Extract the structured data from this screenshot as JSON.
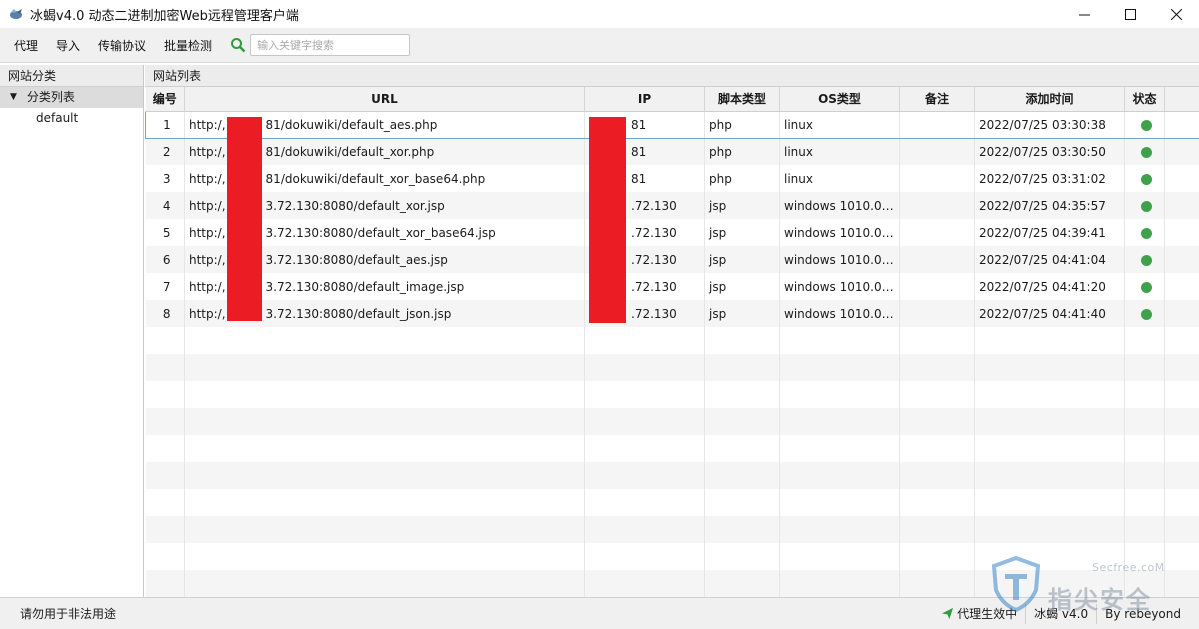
{
  "window": {
    "title": "冰蝎v4.0 动态二进制加密Web远程管理客户端"
  },
  "menu": {
    "items": [
      "代理",
      "导入",
      "传输协议",
      "批量检测"
    ],
    "search_placeholder": "输入关键字搜索"
  },
  "left_panel": {
    "header": "网站分类",
    "tree_root": "分类列表",
    "tree_children": [
      "default"
    ]
  },
  "right_panel": {
    "header": "网站列表",
    "columns": [
      "编号",
      "URL",
      "IP",
      "脚本类型",
      "OS类型",
      "备注",
      "添加时间",
      "状态"
    ],
    "rows": [
      {
        "id": "1",
        "url_prefix": "http:/,",
        "url_suffix": "81/dokuwiki/default_aes.php",
        "ip": "81",
        "script": "php",
        "os": "linux",
        "note": "",
        "time": "2022/07/25 03:30:38",
        "status_color": "#3fa24a"
      },
      {
        "id": "2",
        "url_prefix": "http:/,",
        "url_suffix": "81/dokuwiki/default_xor.php",
        "ip": "81",
        "script": "php",
        "os": "linux",
        "note": "",
        "time": "2022/07/25 03:30:50",
        "status_color": "#3fa24a"
      },
      {
        "id": "3",
        "url_prefix": "http:/,",
        "url_suffix": "81/dokuwiki/default_xor_base64.php",
        "ip": "81",
        "script": "php",
        "os": "linux",
        "note": "",
        "time": "2022/07/25 03:31:02",
        "status_color": "#3fa24a"
      },
      {
        "id": "4",
        "url_prefix": "http:/,",
        "url_suffix": "3.72.130:8080/default_xor.jsp",
        "ip": ".72.130",
        "script": "jsp",
        "os": "windows 1010.0a...",
        "note": "",
        "time": "2022/07/25 04:35:57",
        "status_color": "#3fa24a"
      },
      {
        "id": "5",
        "url_prefix": "http:/,",
        "url_suffix": "3.72.130:8080/default_xor_base64.jsp",
        "ip": ".72.130",
        "script": "jsp",
        "os": "windows 1010.0a...",
        "note": "",
        "time": "2022/07/25 04:39:41",
        "status_color": "#3fa24a"
      },
      {
        "id": "6",
        "url_prefix": "http:/,",
        "url_suffix": "3.72.130:8080/default_aes.jsp",
        "ip": ".72.130",
        "script": "jsp",
        "os": "windows 1010.0a...",
        "note": "",
        "time": "2022/07/25 04:41:04",
        "status_color": "#3fa24a"
      },
      {
        "id": "7",
        "url_prefix": "http:/,",
        "url_suffix": "3.72.130:8080/default_image.jsp",
        "ip": ".72.130",
        "script": "jsp",
        "os": "windows 1010.0a...",
        "note": "",
        "time": "2022/07/25 04:41:20",
        "status_color": "#3fa24a"
      },
      {
        "id": "8",
        "url_prefix": "http:/,",
        "url_suffix": "3.72.130:8080/default_json.jsp",
        "ip": ".72.130",
        "script": "jsp",
        "os": "windows 1010.0a...",
        "note": "",
        "time": "2022/07/25 04:41:40",
        "status_color": "#3fa24a"
      }
    ]
  },
  "statusbar": {
    "left": "请勿用于非法用途",
    "proxy": "代理生效中",
    "version": "冰蝎 v4.0",
    "author": "By rebeyond"
  },
  "watermark": {
    "site": "Secfree.coM",
    "name": "指尖安全"
  }
}
